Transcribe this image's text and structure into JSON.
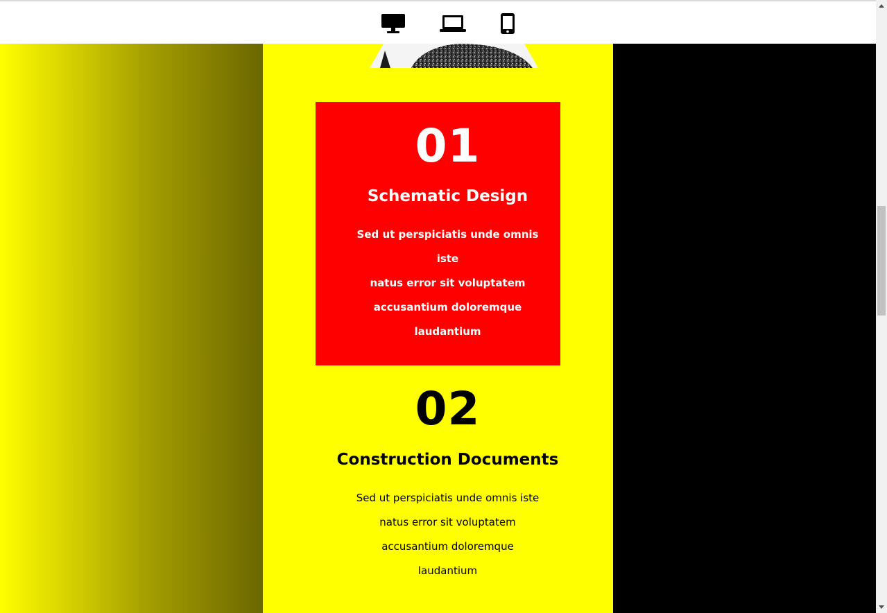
{
  "device_toolbar": {
    "buttons": [
      {
        "icon": "desktop-icon"
      },
      {
        "icon": "laptop-icon"
      },
      {
        "icon": "mobile-icon"
      }
    ]
  },
  "colors": {
    "yellow": "#ffff00",
    "red": "#ff0000",
    "black": "#000000",
    "white": "#ffffff"
  },
  "steps": [
    {
      "number": "01",
      "title": "Schematic Design",
      "lines": [
        "Sed ut perspiciatis unde omnis iste",
        "natus error sit voluptatem",
        "accusantium doloremque",
        "laudantium"
      ]
    },
    {
      "number": "02",
      "title": "Construction Documents",
      "lines": [
        "Sed ut perspiciatis unde omnis iste",
        "natus error sit voluptatem",
        "accusantium doloremque",
        "laudantium"
      ]
    }
  ]
}
